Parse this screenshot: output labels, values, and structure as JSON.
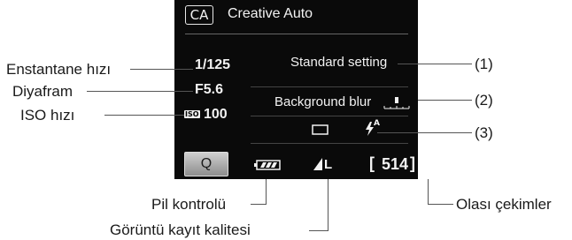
{
  "screen": {
    "mode_badge": "CA",
    "mode_title": "Creative Auto",
    "shutter_speed": "1/125",
    "aperture": "F5.6",
    "iso_badge": "ISO",
    "iso_value": "100",
    "ambience": "Standard setting",
    "background_blur": "Background blur",
    "q_button": "Q",
    "quality": "L",
    "shots_remaining": "514",
    "flash_auto_mark": "A"
  },
  "callouts": {
    "shutter_speed": "Enstantane hızı",
    "aperture": "Diyafram",
    "iso": "ISO hızı",
    "battery": "Pil kontrolü",
    "quality": "Görüntü kayıt kalitesi",
    "shots": "Olası çekimler",
    "ref1": "(1)",
    "ref2": "(2)",
    "ref3": "(3)"
  },
  "icons": {
    "battery": "battery-full-icon",
    "quality": "jpeg-fine-quality-icon",
    "drive": "single-shooting-icon",
    "flash": "auto-flash-icon",
    "blur": "blur-slider-icon"
  }
}
